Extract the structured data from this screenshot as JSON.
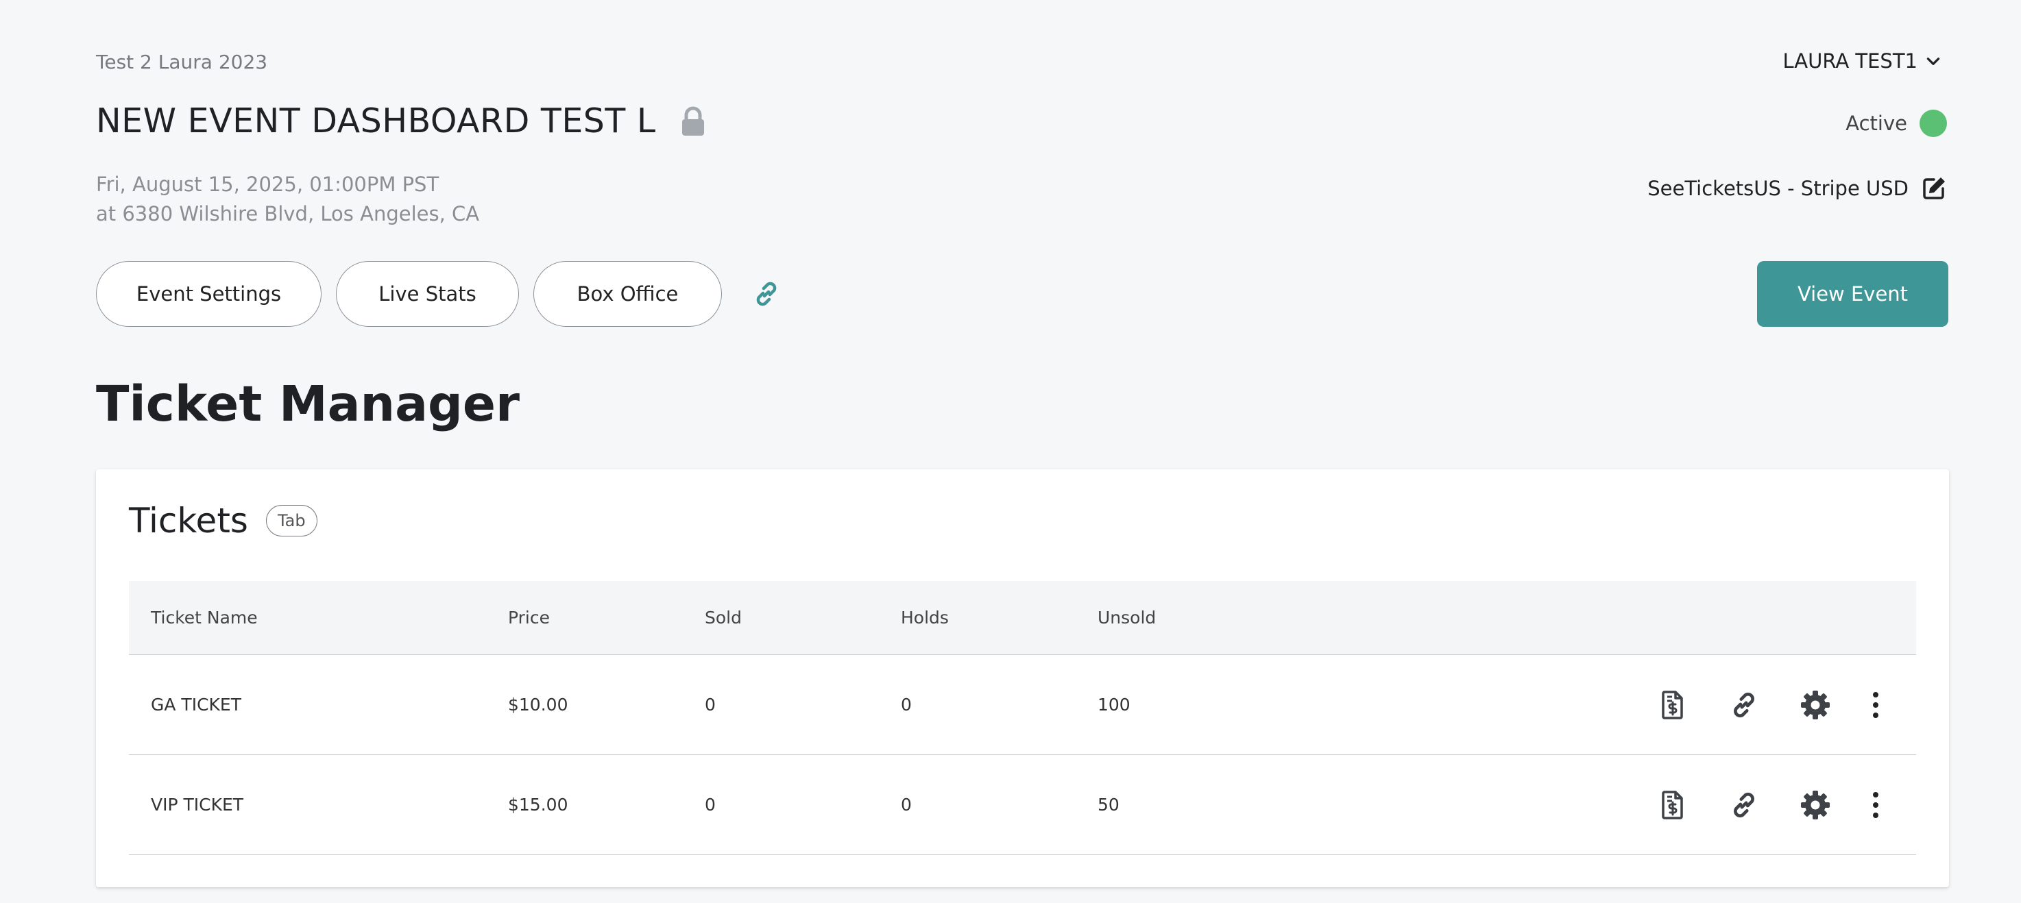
{
  "header": {
    "org_name": "Test 2 Laura 2023",
    "user_name": "LAURA TEST1",
    "event_title": "NEW EVENT DASHBOARD TEST L",
    "status_label": "Active",
    "status_color": "#5bbf74",
    "event_date": "Fri, August 15, 2025, 01:00PM PST",
    "event_venue": "at 6380 Wilshire Blvd, Los Angeles, CA",
    "payment_account": "SeeTicketsUS - Stripe USD"
  },
  "actions": {
    "event_settings": "Event Settings",
    "live_stats": "Live Stats",
    "box_office": "Box Office",
    "view_event": "View Event",
    "accent_color": "#3f9696"
  },
  "ticket_manager": {
    "title": "Ticket Manager",
    "card_title": "Tickets",
    "badge": "Tab",
    "columns": {
      "name": "Ticket Name",
      "price": "Price",
      "sold": "Sold",
      "holds": "Holds",
      "unsold": "Unsold"
    },
    "rows": [
      {
        "name": "GA TICKET",
        "price": "$10.00",
        "sold": "0",
        "holds": "0",
        "unsold": "100"
      },
      {
        "name": "VIP TICKET",
        "price": "$15.00",
        "sold": "0",
        "holds": "0",
        "unsold": "50"
      }
    ],
    "row_icons": [
      "invoice-icon",
      "link-icon",
      "gear-icon",
      "more-vertical-icon"
    ]
  }
}
